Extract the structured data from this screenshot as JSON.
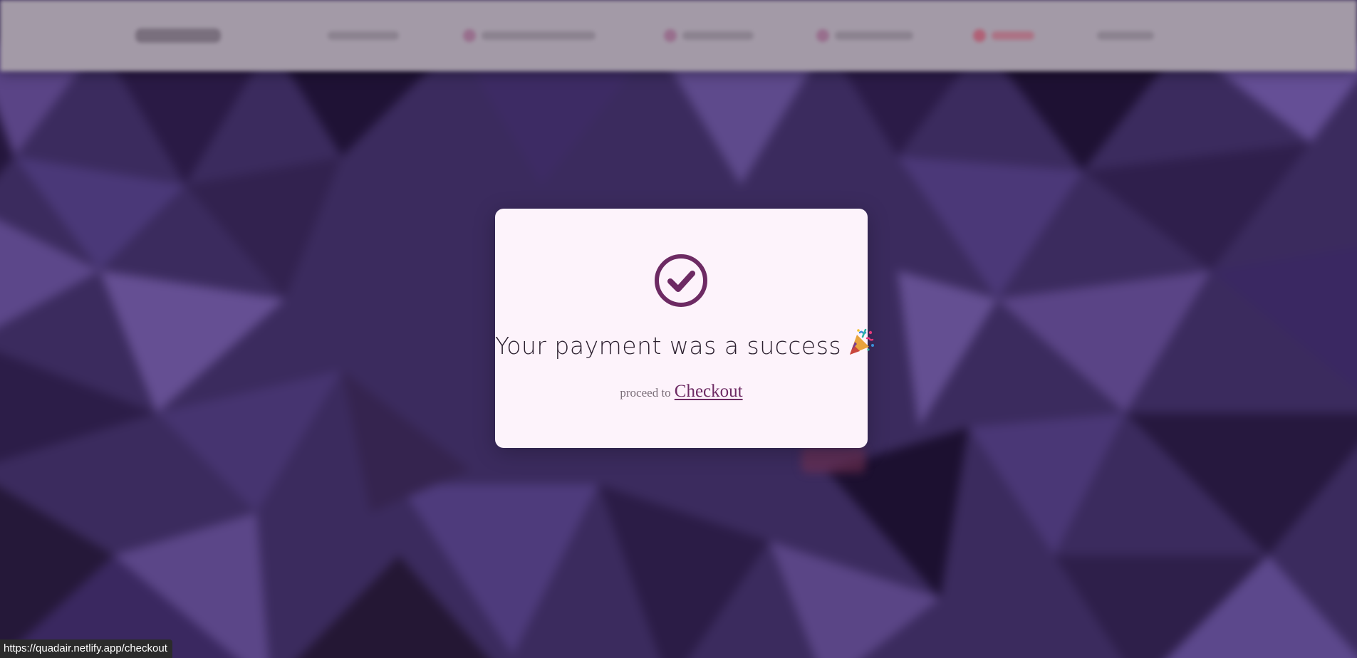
{
  "modal": {
    "headline": "Your payment was a success",
    "proceed_prefix": "proceed to",
    "checkout_link": "Checkout",
    "check_icon": "check-circle-icon",
    "party_icon": "party-popper-icon",
    "accent_color": "#6d2a63"
  },
  "status_bar": {
    "url": "https://quadair.netlify.app/checkout"
  },
  "colors": {
    "modal_background": "#fdf3fb",
    "navbar_background": "#a39aa7",
    "page_background": "#3a2a5c"
  }
}
